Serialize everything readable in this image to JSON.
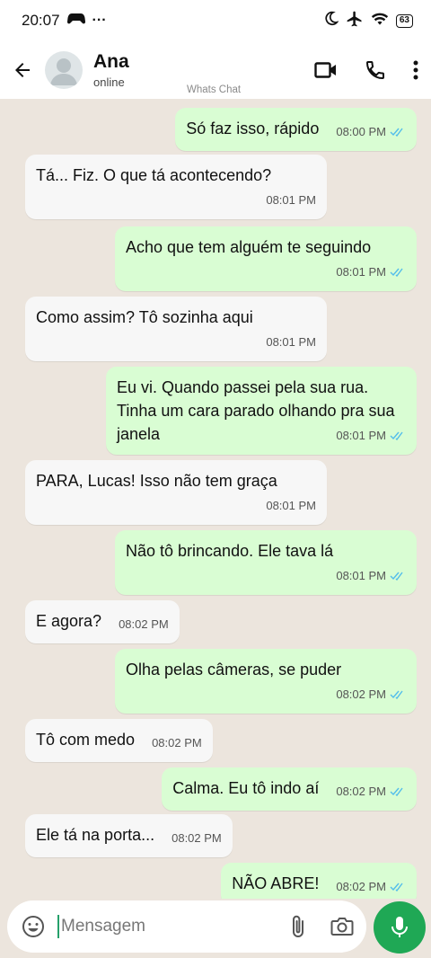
{
  "status_bar": {
    "time": "20:07",
    "extra": "···",
    "battery": "63"
  },
  "header": {
    "name": "Ana",
    "status": "online",
    "watermark": "Whats Chat"
  },
  "messages": [
    {
      "dir": "out",
      "text": "Só faz isso, rápido",
      "time": "08:00 PM"
    },
    {
      "dir": "in",
      "text": "Tá... Fiz. O que tá acontecendo?",
      "time": "08:01 PM"
    },
    {
      "dir": "out",
      "text": "Acho que tem alguém te seguindo",
      "time": "08:01 PM"
    },
    {
      "dir": "in",
      "text": "Como assim? Tô sozinha aqui",
      "time": "08:01 PM"
    },
    {
      "dir": "out",
      "text": "Eu vi. Quando passei pela sua rua. Tinha um cara parado olhando pra sua janela",
      "time": "08:01 PM"
    },
    {
      "dir": "in",
      "text": "PARA, Lucas! Isso não tem graça",
      "time": "08:01 PM"
    },
    {
      "dir": "out",
      "text": "Não tô brincando. Ele tava lá",
      "time": "08:01 PM"
    },
    {
      "dir": "in",
      "text": "E agora?",
      "time": "08:02 PM"
    },
    {
      "dir": "out",
      "text": "Olha pelas câmeras, se puder",
      "time": "08:02 PM"
    },
    {
      "dir": "in",
      "text": "Tô com medo",
      "time": "08:02 PM"
    },
    {
      "dir": "out",
      "text": "Calma. Eu tô indo aí",
      "time": "08:02 PM"
    },
    {
      "dir": "in",
      "text": "Ele tá na porta...",
      "time": "08:02 PM"
    },
    {
      "dir": "out",
      "text": "NÃO ABRE!",
      "time": "08:02 PM"
    }
  ],
  "input": {
    "placeholder": "Mensagem"
  },
  "colors": {
    "outgoing": "#d9fdd3",
    "incoming": "#f7f7f7",
    "accent": "#1fa855",
    "ticks": "#53bdeb"
  }
}
